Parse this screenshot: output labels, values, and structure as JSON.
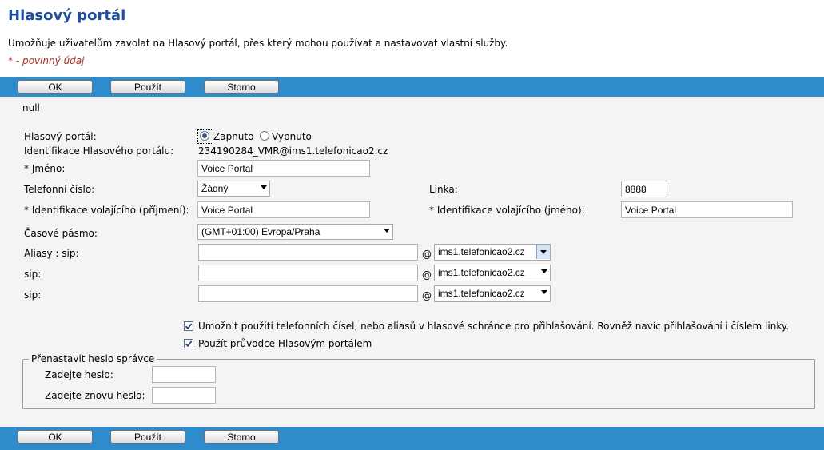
{
  "page": {
    "title": "Hlasový portál",
    "description": "Umožňuje uživatelům zavolat na Hlasový portál, přes který mohou používat a nastavovat vlastní služby.",
    "required_note": "* - povinný údaj"
  },
  "toolbar": {
    "ok_label": "OK",
    "apply_label": "Použít",
    "cancel_label": "Storno"
  },
  "form": {
    "null_text": "null",
    "portal_label": "Hlasový portál:",
    "portal_on_label": "Zapnuto",
    "portal_off_label": "Vypnuto",
    "portal_state": "on",
    "portal_id_label": "Identifikace Hlasového portálu:",
    "portal_id_value": "234190284_VMR@ims1.telefonicao2.cz",
    "name_label": "* Jméno:",
    "name_value": "Voice Portal",
    "phone_label": "Telefonní číslo:",
    "phone_value": "Žádný",
    "line_label": "Linka:",
    "line_value": "8888",
    "caller_last_label": "* Identifikace volajícího (příjmení):",
    "caller_last_value": "Voice Portal",
    "caller_first_label": "* Identifikace volajícího (jméno):",
    "caller_first_value": "Voice Portal",
    "timezone_label": "Časové pásmo:",
    "timezone_value": "(GMT+01:00) Evropa/Praha",
    "aliases": [
      {
        "label": "Aliasy : sip:",
        "value": "",
        "at": "@",
        "domain": "ims1.telefonicao2.cz"
      },
      {
        "label": "sip:",
        "value": "",
        "at": "@",
        "domain": "ims1.telefonicao2.cz"
      },
      {
        "label": "sip:",
        "value": "",
        "at": "@",
        "domain": "ims1.telefonicao2.cz"
      }
    ],
    "option_login_label": "Umožnit použití telefonních čísel, nebo aliasů v hlasové schránce pro přihlašování. Rovněž navíc přihlašování i číslem linky.",
    "option_login_checked": true,
    "option_wizard_label": "Použít průvodce Hlasovým portálem",
    "option_wizard_checked": true,
    "reset_legend": "Přenastavit heslo správce",
    "password_label": "Zadejte heslo:",
    "password_confirm_label": "Zadejte znovu heslo:"
  }
}
